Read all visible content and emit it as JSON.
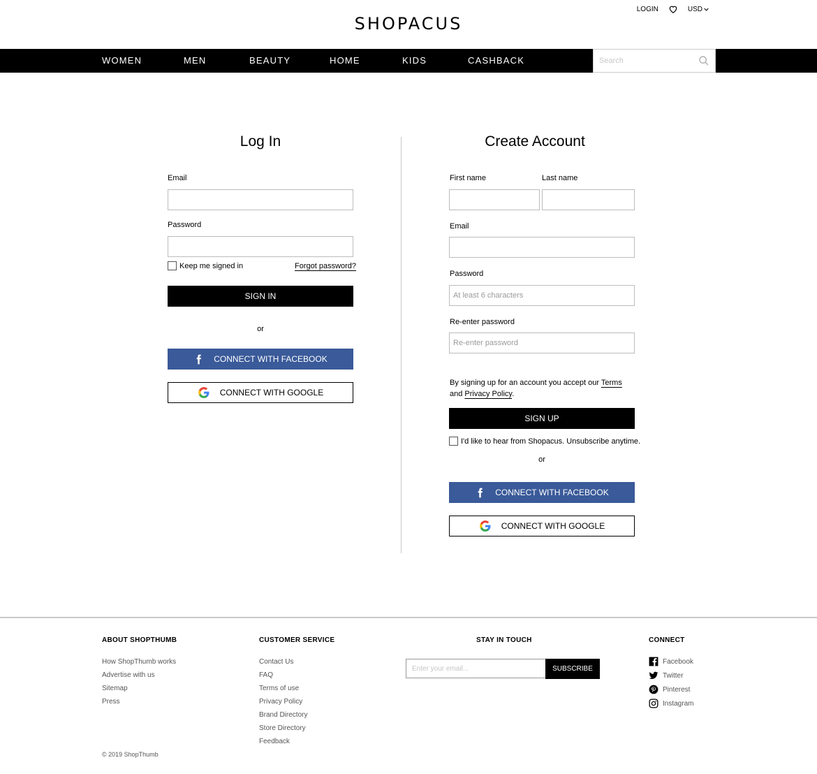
{
  "header": {
    "logo": "SHOPACUS",
    "login": "LOGIN",
    "currency": "USD"
  },
  "nav": {
    "items": [
      "WOMEN",
      "MEN",
      "BEAUTY",
      "HOME",
      "KIDS",
      "CASHBACK"
    ],
    "search_placeholder": "Search"
  },
  "login": {
    "title": "Log In",
    "email_label": "Email",
    "password_label": "Password",
    "keep_signed_in": "Keep me signed in",
    "forgot_password": "Forgot password?",
    "sign_in": "SIGN IN",
    "or": "or",
    "facebook": "CONNECT WITH FACEBOOK",
    "google": "CONNECT WITH GOOGLE"
  },
  "signup": {
    "title": "Create Account",
    "first_name_label": "First name",
    "last_name_label": "Last name",
    "email_label": "Email",
    "password_label": "Password",
    "password_placeholder": "At least 6 characters",
    "reenter_label": "Re-enter password",
    "reenter_placeholder": "Re-enter password",
    "terms_prefix": "By signing up for an account you accept our",
    "terms_link": "Terms",
    "and": "and",
    "privacy_link": "Privacy Policy",
    "period": ".",
    "sign_up": "SIGN UP",
    "newsletter": "I'd like to hear from Shopacus. Unsubscribe anytime.",
    "or": "or",
    "facebook": "CONNECT WITH FACEBOOK",
    "google": "CONNECT WITH GOOGLE"
  },
  "footer": {
    "about": {
      "title": "ABOUT SHOPTHUMB",
      "links": [
        "How ShopThumb works",
        "Advertise with us",
        "Sitemap",
        "Press"
      ]
    },
    "service": {
      "title": "CUSTOMER SERVICE",
      "links": [
        "Contact Us",
        "FAQ",
        "Terms of use",
        "Privacy Policy",
        "Brand Directory",
        "Store Directory",
        "Feedback"
      ]
    },
    "stay": {
      "title": "STAY IN TOUCH",
      "placeholder": "Enter your email...",
      "button": "SUBSCRIBE"
    },
    "connect": {
      "title": "CONNECT",
      "links": [
        "Facebook",
        "Twitter",
        "Pinterest",
        "Instagram"
      ]
    },
    "copyright": "© 2019 ShopThumb"
  },
  "colors": {
    "facebook": "#3a5a99",
    "nav_bg": "#000000"
  }
}
